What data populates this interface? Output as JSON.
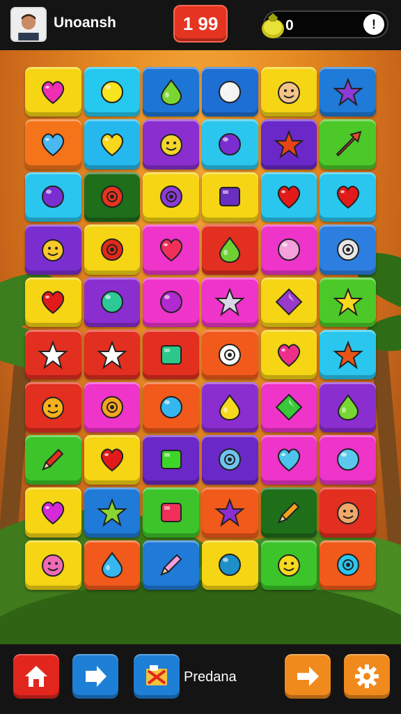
{
  "header": {
    "username": "Unoansh",
    "score": "1 99",
    "coins": "0",
    "coin_button_glyph": "!"
  },
  "board": {
    "rows": [
      [
        {
          "color": "#f5d514",
          "icon": "heart",
          "fg": "#ee2fb1"
        },
        {
          "color": "#25c8ee",
          "icon": "ball",
          "fg": "#f7e41d"
        },
        {
          "color": "#1d76d6",
          "icon": "drop",
          "fg": "#7ad630"
        },
        {
          "color": "#1e6fd3",
          "icon": "ball",
          "fg": "#f4f4f4"
        },
        {
          "color": "#f5d514",
          "icon": "face",
          "fg": "#f3c48a"
        },
        {
          "color": "#1f7ad8",
          "icon": "star",
          "fg": "#8b3bd6"
        }
      ],
      [
        {
          "color": "#f5741a",
          "icon": "heart",
          "fg": "#49b8f0"
        },
        {
          "color": "#25b8ee",
          "icon": "heart",
          "fg": "#f7d81d"
        },
        {
          "color": "#8a2ed0",
          "icon": "face",
          "fg": "#f4d52c"
        },
        {
          "color": "#2ac6ee",
          "icon": "ball",
          "fg": "#7a2ed0"
        },
        {
          "color": "#6a28c8",
          "icon": "star",
          "fg": "#e64416"
        },
        {
          "color": "#4cc928",
          "icon": "arrow",
          "fg": "#e84a22"
        }
      ],
      [
        {
          "color": "#2ac6ee",
          "icon": "ball",
          "fg": "#7a2ed0"
        },
        {
          "color": "#1e6e1a",
          "icon": "ring",
          "fg": "#e8341c"
        },
        {
          "color": "#f5d514",
          "icon": "ring",
          "fg": "#8b3bd6"
        },
        {
          "color": "#f5d514",
          "icon": "square",
          "fg": "#6a2ec0"
        },
        {
          "color": "#2ac6ee",
          "icon": "heart",
          "fg": "#e21a1a"
        },
        {
          "color": "#2ac6ee",
          "icon": "heart",
          "fg": "#e21a1a"
        }
      ],
      [
        {
          "color": "#7a2ed0",
          "icon": "face",
          "fg": "#f7c92a"
        },
        {
          "color": "#f5d514",
          "icon": "ring",
          "fg": "#e22a1a"
        },
        {
          "color": "#ee34c9",
          "icon": "heart",
          "fg": "#f0305a"
        },
        {
          "color": "#e22f20",
          "icon": "drop",
          "fg": "#6ed034"
        },
        {
          "color": "#ee34c9",
          "icon": "ball",
          "fg": "#f3a0dd"
        },
        {
          "color": "#2c7fe0",
          "icon": "ring",
          "fg": "#e6e6e6"
        }
      ],
      [
        {
          "color": "#f5d514",
          "icon": "heart",
          "fg": "#e21a1a"
        },
        {
          "color": "#8a2ed0",
          "icon": "ball",
          "fg": "#2cc896"
        },
        {
          "color": "#ee34c9",
          "icon": "ball",
          "fg": "#b02ad0"
        },
        {
          "color": "#ee34c9",
          "icon": "star",
          "fg": "#d7d7e8"
        },
        {
          "color": "#f5d514",
          "icon": "diamond",
          "fg": "#9a3ac8"
        },
        {
          "color": "#4cc928",
          "icon": "star",
          "fg": "#f6d81d"
        }
      ],
      [
        {
          "color": "#e22f20",
          "icon": "star",
          "fg": "#ffffff"
        },
        {
          "color": "#e22f20",
          "icon": "star",
          "fg": "#ffffff"
        },
        {
          "color": "#e22f20",
          "icon": "square",
          "fg": "#2cc88a"
        },
        {
          "color": "#f15a1a",
          "icon": "ring",
          "fg": "#ffffff"
        },
        {
          "color": "#f5d514",
          "icon": "heart",
          "fg": "#ee2f8a"
        },
        {
          "color": "#2ac6ee",
          "icon": "star",
          "fg": "#e8541a"
        }
      ],
      [
        {
          "color": "#e22f20",
          "icon": "face",
          "fg": "#f7b11d"
        },
        {
          "color": "#ee34c9",
          "icon": "ring",
          "fg": "#f5a51d"
        },
        {
          "color": "#f15a1a",
          "icon": "ball",
          "fg": "#35b6ee"
        },
        {
          "color": "#8a2ed0",
          "icon": "drop",
          "fg": "#f6d81d"
        },
        {
          "color": "#ee34c9",
          "icon": "diamond",
          "fg": "#39c83a"
        },
        {
          "color": "#8a2ed0",
          "icon": "drop",
          "fg": "#78d632"
        }
      ],
      [
        {
          "color": "#3cc42a",
          "icon": "pencil",
          "fg": "#e22f20"
        },
        {
          "color": "#f5d514",
          "icon": "heart",
          "fg": "#e21a1a"
        },
        {
          "color": "#6a28c8",
          "icon": "square",
          "fg": "#3fd42a"
        },
        {
          "color": "#6a28c8",
          "icon": "ring",
          "fg": "#6fc3ef"
        },
        {
          "color": "#ee34c9",
          "icon": "heart",
          "fg": "#4cc4ee"
        },
        {
          "color": "#ee34c9",
          "icon": "ball",
          "fg": "#5cc8ee"
        }
      ],
      [
        {
          "color": "#f5d514",
          "icon": "heart",
          "fg": "#d52ad8"
        },
        {
          "color": "#1f7ad8",
          "icon": "star",
          "fg": "#8ad632"
        },
        {
          "color": "#3cc42a",
          "icon": "square",
          "fg": "#f0305a"
        },
        {
          "color": "#f15a1a",
          "icon": "star",
          "fg": "#8a2ed0"
        },
        {
          "color": "#1e6e1a",
          "icon": "pencil",
          "fg": "#f3a21d"
        },
        {
          "color": "#e22f20",
          "icon": "face",
          "fg": "#f0a86a"
        }
      ],
      [
        {
          "color": "#f5d514",
          "icon": "face",
          "fg": "#f06ab5"
        },
        {
          "color": "#f15a1a",
          "icon": "drop",
          "fg": "#35b6ee"
        },
        {
          "color": "#1f7ad8",
          "icon": "pencil",
          "fg": "#f3a0dd"
        },
        {
          "color": "#f5d514",
          "icon": "ball",
          "fg": "#1d90c8"
        },
        {
          "color": "#3cc42a",
          "icon": "face",
          "fg": "#f6d81d"
        },
        {
          "color": "#f15a1a",
          "icon": "ring",
          "fg": "#2ac6ee"
        }
      ]
    ]
  },
  "footer": {
    "premium_label": "Predana",
    "buttons": [
      {
        "name": "home-button",
        "icon": "home-icon"
      },
      {
        "name": "share-button",
        "icon": "share-icon"
      },
      {
        "name": "premium-box-button",
        "icon": "box-icon"
      },
      {
        "name": "next-button",
        "icon": "arrow-right-icon"
      },
      {
        "name": "settings-button",
        "icon": "gear-icon"
      }
    ]
  }
}
